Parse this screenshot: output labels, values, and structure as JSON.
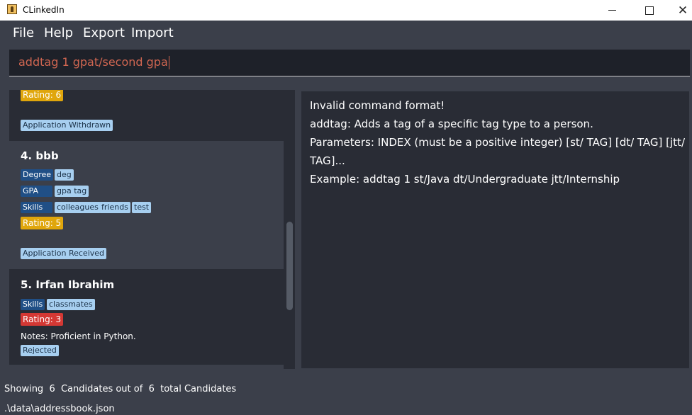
{
  "window": {
    "title": "CLinkedIn",
    "min_symbol": "",
    "max_symbol": "",
    "close_symbol": "✕"
  },
  "menu": {
    "file": "File",
    "help": "Help",
    "export": "Export",
    "import": "Import"
  },
  "command": {
    "value": "addtag 1 gpat/second gpa"
  },
  "colors": {
    "rating_yellow": "#e0a60c",
    "rating_red": "#d43834",
    "tag_light": "#a7cff0",
    "tag_dark": "#204f86",
    "command_text": "#d06651"
  },
  "list": {
    "partial_card": {
      "rating": "Rating: 6",
      "status": "Application Withdrawn"
    },
    "card4": {
      "name": "4.  bbb",
      "degree_label": "Degree",
      "degree_tag": "deg",
      "gpa_label": "GPA",
      "gpa_tag": "gpa tag",
      "skills_label": "Skills",
      "skills_tags": [
        "colleagues",
        "friends",
        "test"
      ],
      "rating": "Rating: 5",
      "status": "Application Received"
    },
    "card5": {
      "name": "5.  Irfan Ibrahim",
      "skills_label": "Skills",
      "skills_tag": "classmates",
      "rating": "Rating: 3",
      "notes": "Notes: Proficient in Python.",
      "status": "Rejected"
    }
  },
  "result": {
    "lines": [
      "Invalid command format!",
      "addtag: Adds a tag of a specific tag type to a person.",
      "Parameters: INDEX (must be a positive integer) [st/ TAG] [dt/ TAG] [jtt/",
      "TAG]...",
      "Example: addtag 1 st/Java dt/Undergraduate jtt/Internship"
    ]
  },
  "status": {
    "summary": "Showing  6  Candidates out of  6  total Candidates",
    "path": ".\\data\\addressbook.json"
  }
}
